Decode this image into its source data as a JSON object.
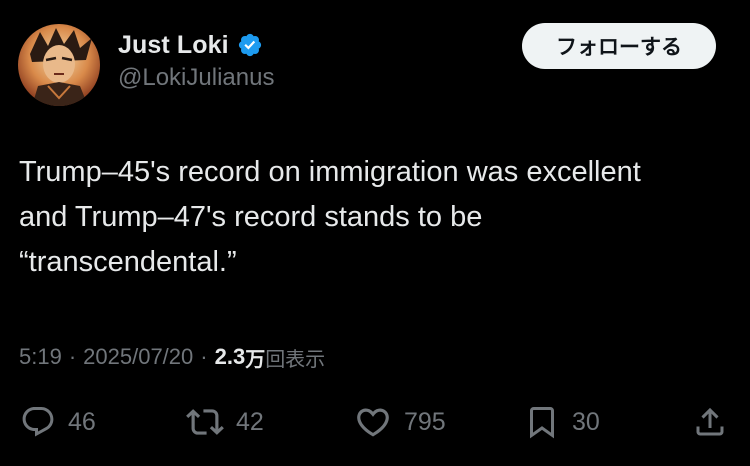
{
  "author": {
    "display_name": "Just Loki",
    "handle": "@LokiJulianus",
    "verified": true,
    "avatar_icon": "anime-character-avatar"
  },
  "follow_button": {
    "label": "フォローする"
  },
  "tweet": {
    "lines": [
      "Trump–45's record on immigration was excellent",
      "and Trump–47's record stands to be",
      "“transcendental.”"
    ]
  },
  "meta": {
    "time": "5:19",
    "separator": "·",
    "date": "2025/07/20",
    "views_count": "2.3",
    "views_unit": "万",
    "views_label": "回表示"
  },
  "actions": {
    "reply": {
      "icon": "reply-icon",
      "count": "46"
    },
    "retweet": {
      "icon": "retweet-icon",
      "count": "42"
    },
    "like": {
      "icon": "heart-icon",
      "count": "795"
    },
    "bookmark": {
      "icon": "bookmark-icon",
      "count": "30"
    },
    "share": {
      "icon": "share-icon"
    }
  },
  "colors": {
    "background": "#000000",
    "primary_text": "#e7e9ea",
    "secondary_text": "#71767b",
    "verified_blue": "#1d9bf0",
    "follow_button_bg": "#eff3f4"
  }
}
